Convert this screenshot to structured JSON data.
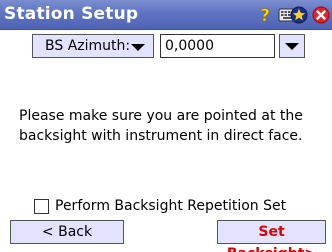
{
  "window": {
    "title": "Station Setup",
    "icons": [
      "help-icon",
      "keyboard-icon",
      "star-icon",
      "close-icon"
    ]
  },
  "backsight": {
    "mode_label": "BS Azimuth:",
    "azimuth_value": "0,0000"
  },
  "message": "Please make sure you are pointed at the backsight with instrument in direct face.",
  "repetition": {
    "label": "Perform Backsight Repetition Set",
    "checked": false
  },
  "buttons": {
    "back": "< Back",
    "set_backsight": "Set Backsight>"
  },
  "colors": {
    "titlebar": "#5f74c2",
    "button_bg": "#e3e3ff",
    "accent_red": "#e00000"
  }
}
